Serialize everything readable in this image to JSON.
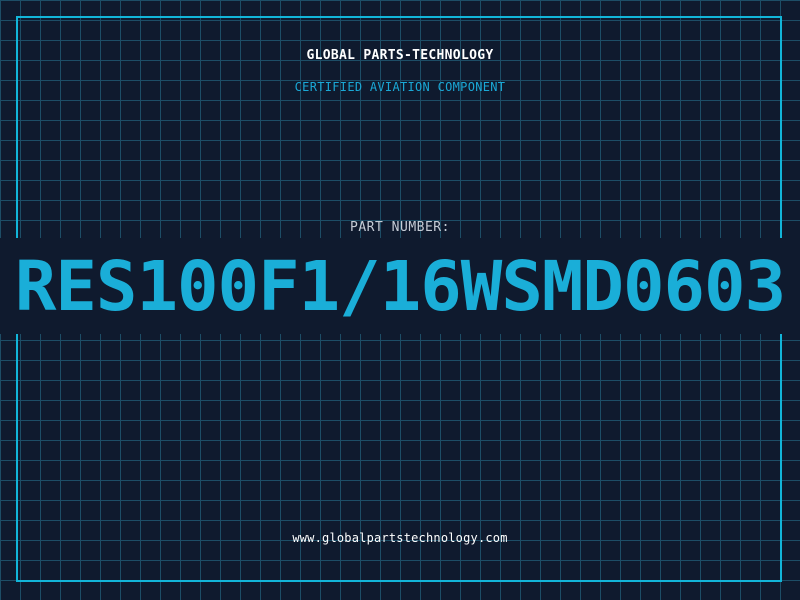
{
  "header": {
    "company": "GLOBAL PARTS-TECHNOLOGY",
    "subtitle": "CERTIFIED AVIATION COMPONENT"
  },
  "part": {
    "label": "PART NUMBER:",
    "number": "RES100F1/16WSMD0603"
  },
  "footer": {
    "website": "www.globalpartstechnology.com"
  },
  "colors": {
    "background": "#0f1a2e",
    "grid": "#1d4d66",
    "accent": "#1aaed8",
    "frame": "#12b5d9",
    "text": "#ffffff"
  }
}
